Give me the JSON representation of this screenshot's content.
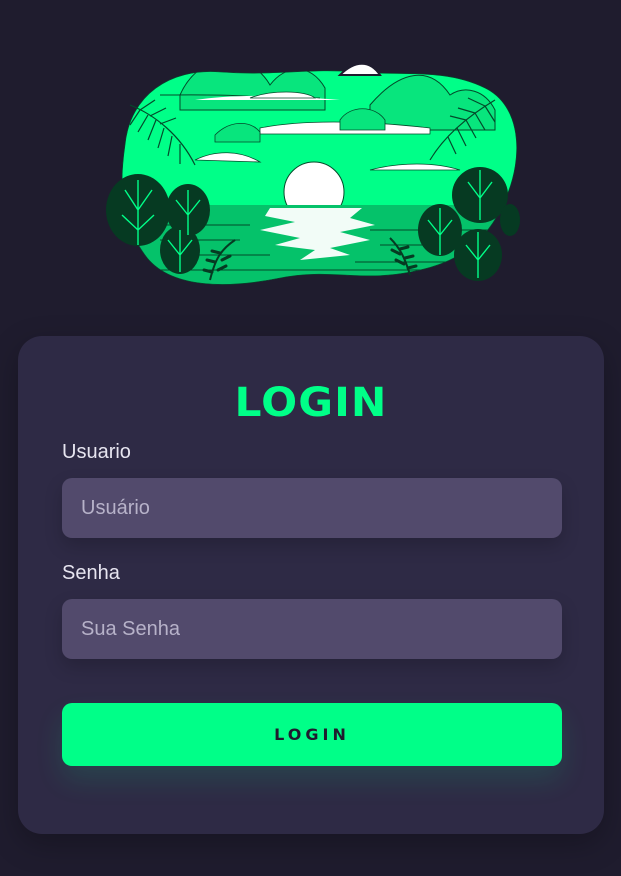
{
  "hero": {
    "image_name": "tropical-sunset-illustration",
    "colors": {
      "accent": "#00ff88",
      "dark_leaf": "#06331f",
      "water": "#05b862"
    }
  },
  "login": {
    "title": "LOGIN",
    "username": {
      "label": "Usuario",
      "placeholder": "Usuário",
      "value": ""
    },
    "password": {
      "label": "Senha",
      "placeholder": "Sua Senha",
      "value": ""
    },
    "submit_label": "LOGIN"
  },
  "colors": {
    "background": "#1f1c2e",
    "card": "#2e2a45",
    "input": "#524a6c",
    "accent": "#00ff88",
    "text": "#e7e5f0"
  }
}
